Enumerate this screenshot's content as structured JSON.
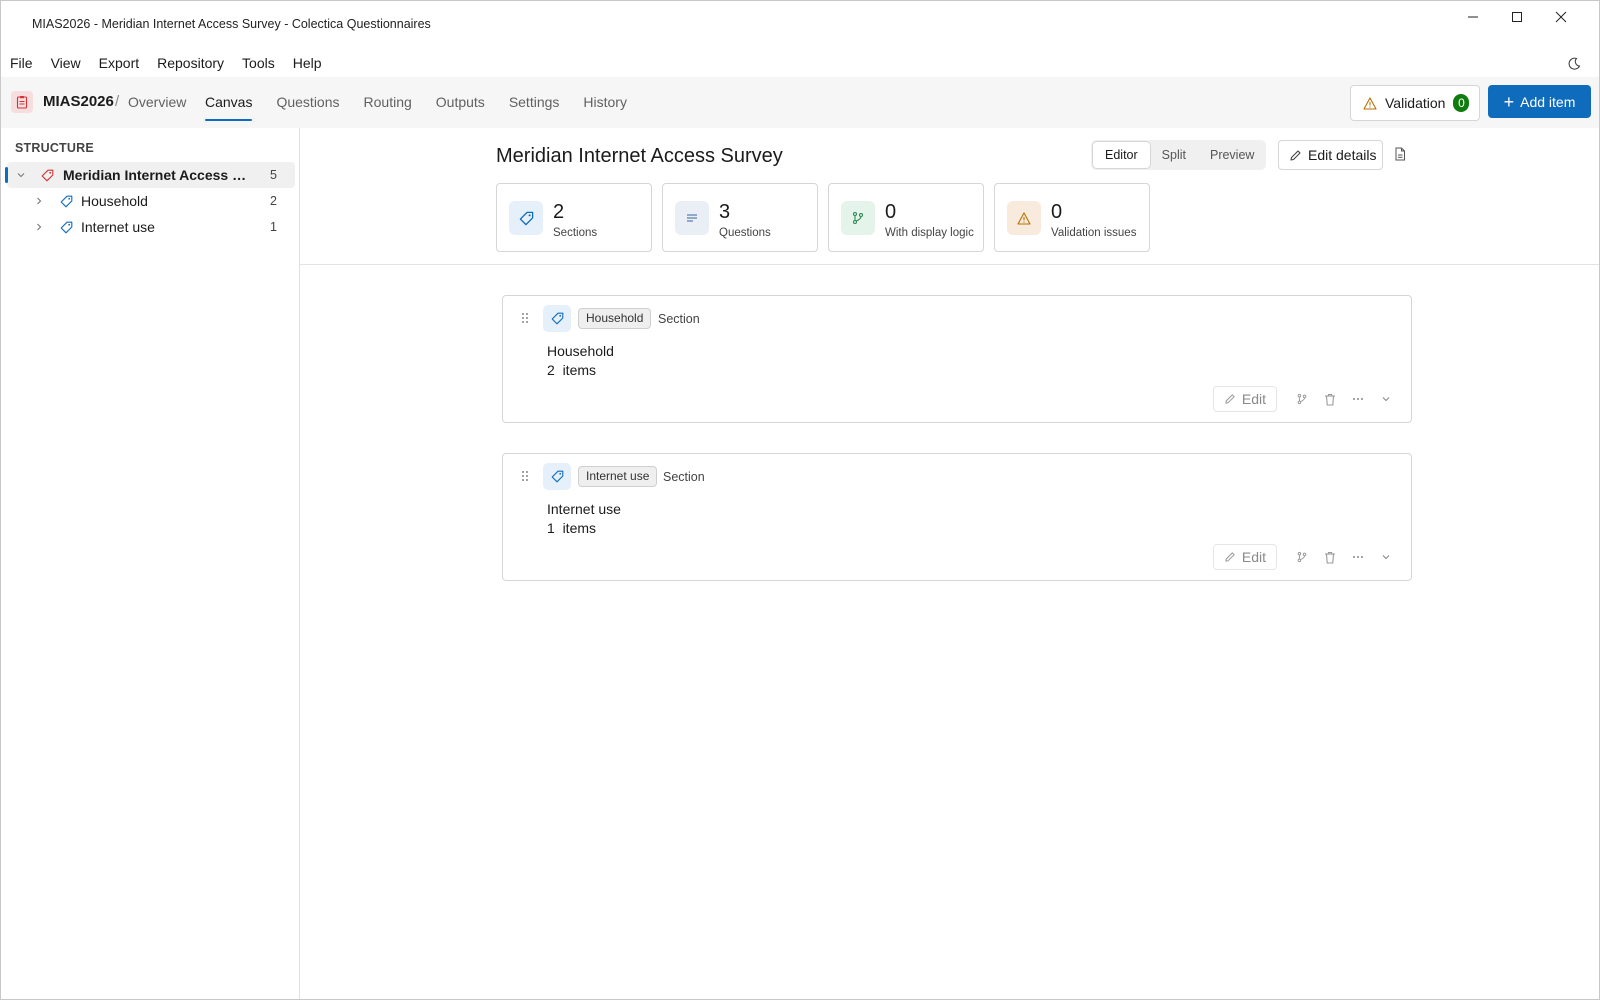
{
  "window": {
    "title": "MIAS2026 - Meridian Internet Access Survey - Colectica Questionnaires",
    "controls": {
      "minimize": "minimize-icon",
      "maximize": "maximize-icon",
      "close": "close-icon"
    }
  },
  "menu": {
    "items": [
      "File",
      "View",
      "Export",
      "Repository",
      "Tools",
      "Help"
    ],
    "theme_icon": "moon-icon"
  },
  "nav": {
    "project": "MIAS2026",
    "separator": "/",
    "overview": "Overview",
    "tabs": [
      {
        "label": "Canvas",
        "active": true
      },
      {
        "label": "Questions",
        "active": false
      },
      {
        "label": "Routing",
        "active": false
      },
      {
        "label": "Outputs",
        "active": false
      },
      {
        "label": "Settings",
        "active": false
      },
      {
        "label": "History",
        "active": false
      }
    ],
    "validation_label": "Validation",
    "validation_count": "0",
    "add_label": "Add item",
    "add_symbol": "+"
  },
  "sidebar": {
    "heading": "STRUCTURE",
    "tree": [
      {
        "label": "Meridian Internet Access Su...",
        "count": "5",
        "level": 0,
        "expanded": true,
        "selected": true
      },
      {
        "label": "Household",
        "count": "2",
        "level": 1,
        "expanded": false,
        "selected": false
      },
      {
        "label": "Internet use",
        "count": "1",
        "level": 1,
        "expanded": false,
        "selected": false
      }
    ]
  },
  "main": {
    "title": "Meridian Internet Access Survey",
    "view_modes": [
      "Editor",
      "Split",
      "Preview"
    ],
    "active_view": "Editor",
    "edit_details_label": "Edit details",
    "stats": [
      {
        "value": "2",
        "label": "Sections",
        "icon": "tag-icon"
      },
      {
        "value": "3",
        "label": "Questions",
        "icon": "lines-icon"
      },
      {
        "value": "0",
        "label": "With display logic",
        "icon": "branch-icon"
      },
      {
        "value": "0",
        "label": "Validation issues",
        "icon": "warning-icon"
      }
    ],
    "sections": [
      {
        "chip": "Household",
        "type": "Section",
        "name": "Household",
        "items": "2  items",
        "edit_label": "Edit"
      },
      {
        "chip": "Internet use",
        "type": "Section",
        "name": "Internet use",
        "items": "1  items",
        "edit_label": "Edit"
      }
    ]
  },
  "colors": {
    "accent": "#0f6cbd",
    "success": "#107c10",
    "project_icon": "#d13438"
  }
}
